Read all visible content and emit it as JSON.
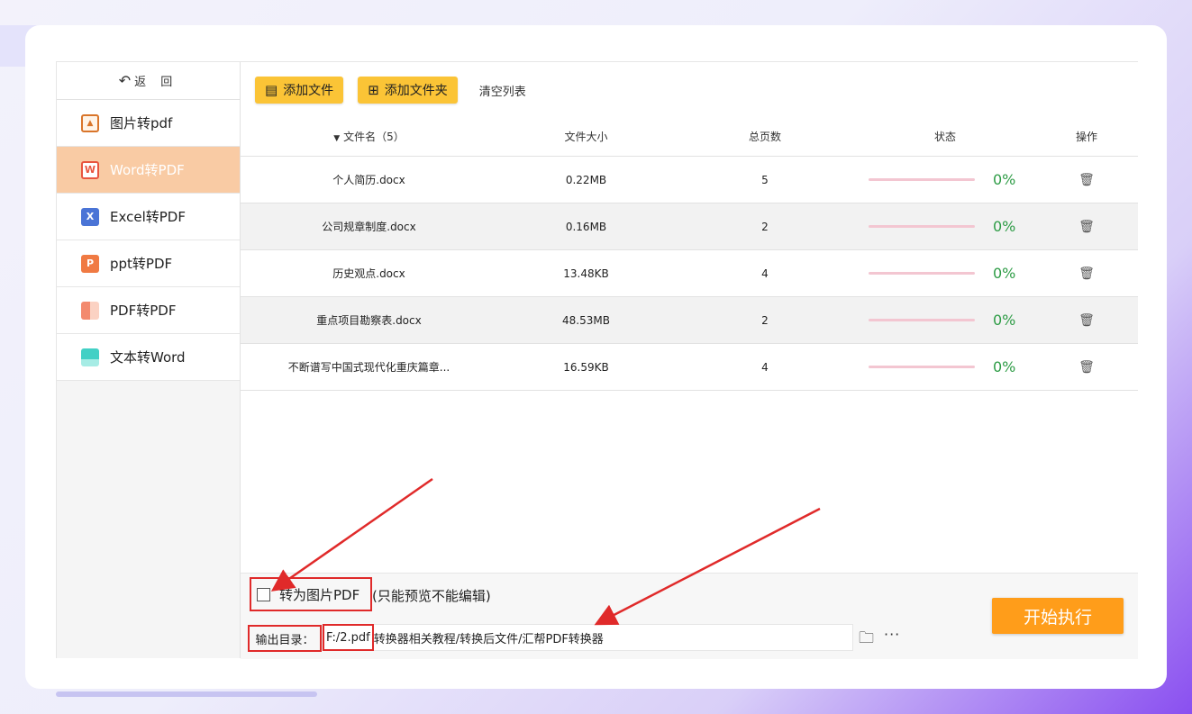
{
  "sidebar": {
    "back_icon": "↶",
    "back_label": "返 回",
    "items": [
      {
        "label": "图片转pdf",
        "icon": "image-icon",
        "glyph": "▲"
      },
      {
        "label": "Word转PDF",
        "icon": "word-icon",
        "glyph": "W"
      },
      {
        "label": "Excel转PDF",
        "icon": "excel-icon",
        "glyph": "X"
      },
      {
        "label": "ppt转PDF",
        "icon": "ppt-icon",
        "glyph": "P"
      },
      {
        "label": "PDF转PDF",
        "icon": "pdf-icon",
        "glyph": ""
      },
      {
        "label": "文本转Word",
        "icon": "text-icon",
        "glyph": ""
      }
    ],
    "active_index": 1
  },
  "toolbar": {
    "add_file": "添加文件",
    "add_file_icon": "▤",
    "add_folder": "添加文件夹",
    "add_folder_icon": "⊞",
    "clear_list": "清空列表"
  },
  "table": {
    "headers": {
      "sort_icon": "▼",
      "name": "文件名（5）",
      "size": "文件大小",
      "pages": "总页数",
      "status": "状态",
      "action": "操作"
    },
    "rows": [
      {
        "name": "个人简历.docx",
        "size": "0.22MB",
        "pages": "5",
        "progress": "0%"
      },
      {
        "name": "公司规章制度.docx",
        "size": "0.16MB",
        "pages": "2",
        "progress": "0%"
      },
      {
        "name": "历史观点.docx",
        "size": "13.48KB",
        "pages": "4",
        "progress": "0%"
      },
      {
        "name": "重点项目勘察表.docx",
        "size": "48.53MB",
        "pages": "2",
        "progress": "0%"
      },
      {
        "name": "不断谱写中国式现代化重庆篇章...",
        "size": "16.59KB",
        "pages": "4",
        "progress": "0%"
      }
    ],
    "trash_icon": "🗑"
  },
  "footer": {
    "checkbox_label": "转为图片PDF",
    "checkbox_note": "(只能预览不能编辑)",
    "output_label": "输出目录：",
    "output_prefix": "F:/2.pdf",
    "output_rest": "转换器相关教程/转换后文件/汇帮PDF转换器",
    "folder_icon": "🗀",
    "more_icon": "···",
    "start_button": "开始执行"
  },
  "colors": {
    "accent_yellow": "#fbc436",
    "start_orange": "#ff9d1a",
    "active_nav": "#f9cba4",
    "progress_green": "#2e9c46",
    "annotation_red": "#e02a2a"
  }
}
